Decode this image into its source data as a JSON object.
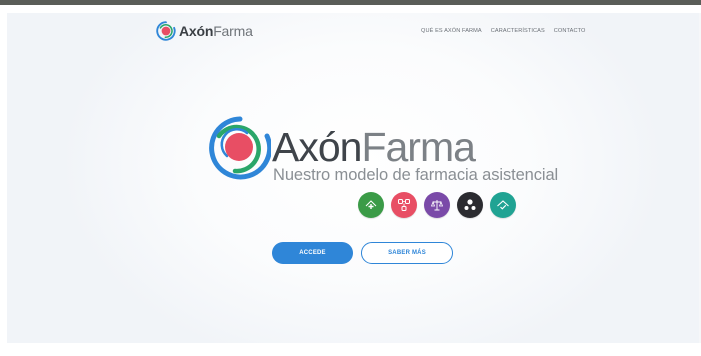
{
  "brand": {
    "name_bold": "Axón",
    "name_light": "Farma",
    "tagline": "Nuestro modelo de farmacia asistencial"
  },
  "nav": {
    "items": [
      {
        "label": "QUÉ ES AXÓN FARMA"
      },
      {
        "label": "CARACTERÍSTICAS"
      },
      {
        "label": "CONTACTO"
      }
    ]
  },
  "features": {
    "circles": [
      {
        "icon": "pharmacy-cross-icon",
        "color": "#3b9b47"
      },
      {
        "icon": "network-nodes-icon",
        "color": "#e84e64"
      },
      {
        "icon": "scale-icon",
        "color": "#7a4aa8"
      },
      {
        "icon": "molecule-icon",
        "color": "#2b2b30"
      },
      {
        "icon": "house-check-icon",
        "color": "#20a393"
      }
    ]
  },
  "actions": {
    "primary_label": "ACCEDE",
    "secondary_label": "SABER MÁS"
  },
  "colors": {
    "accent": "#2f86d8",
    "logo_ring_blue": "#2f86d8",
    "logo_ring_green": "#2aa66a",
    "logo_core": "#e84e64"
  }
}
